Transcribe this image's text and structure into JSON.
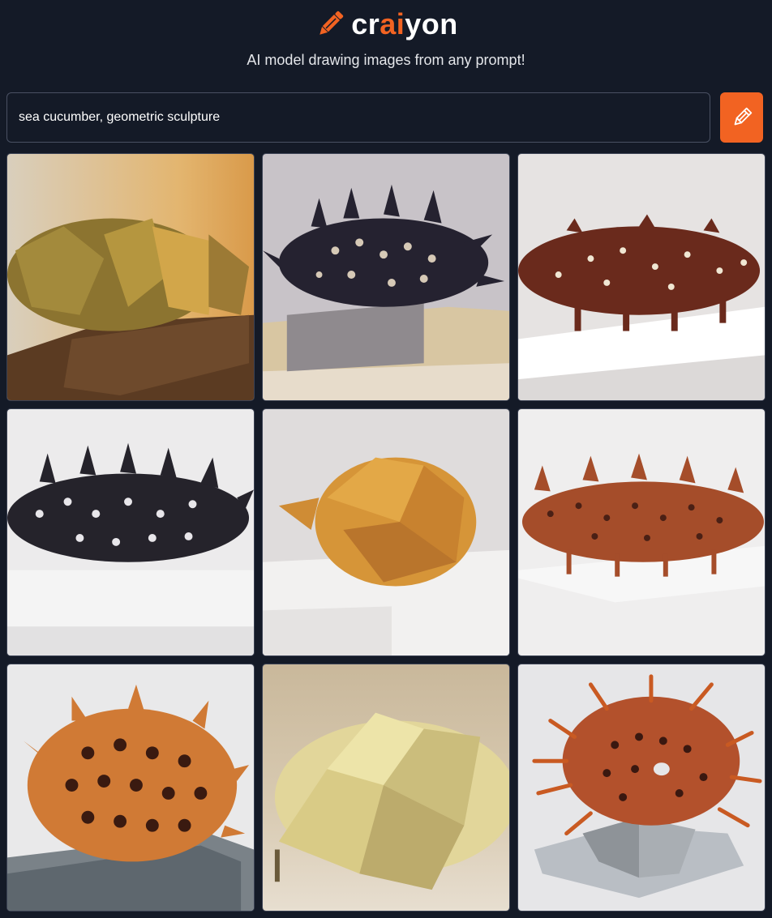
{
  "header": {
    "logo": {
      "prefix": "cr",
      "highlight": "ai",
      "suffix": "yon",
      "icon": "pencil-icon"
    },
    "tagline": "AI model drawing images from any prompt!"
  },
  "search": {
    "value": "sea cucumber, geometric sculpture",
    "button_icon": "pencil-icon"
  },
  "colors": {
    "accent": "#f26322",
    "background": "#141a27"
  },
  "results": [
    {
      "label": "ochre faceted sculpture on wooden base"
    },
    {
      "label": "black spiky sculpture with holes"
    },
    {
      "label": "brown dotted sculpture on white pedestal"
    },
    {
      "label": "black spiky sculpture on white"
    },
    {
      "label": "orange faceted blob on white"
    },
    {
      "label": "rust spiky sea cucumber"
    },
    {
      "label": "orange dotted spiky blob on grey base"
    },
    {
      "label": "cream faceted sculpture"
    },
    {
      "label": "tentacled dotted sculpture on grey"
    }
  ]
}
